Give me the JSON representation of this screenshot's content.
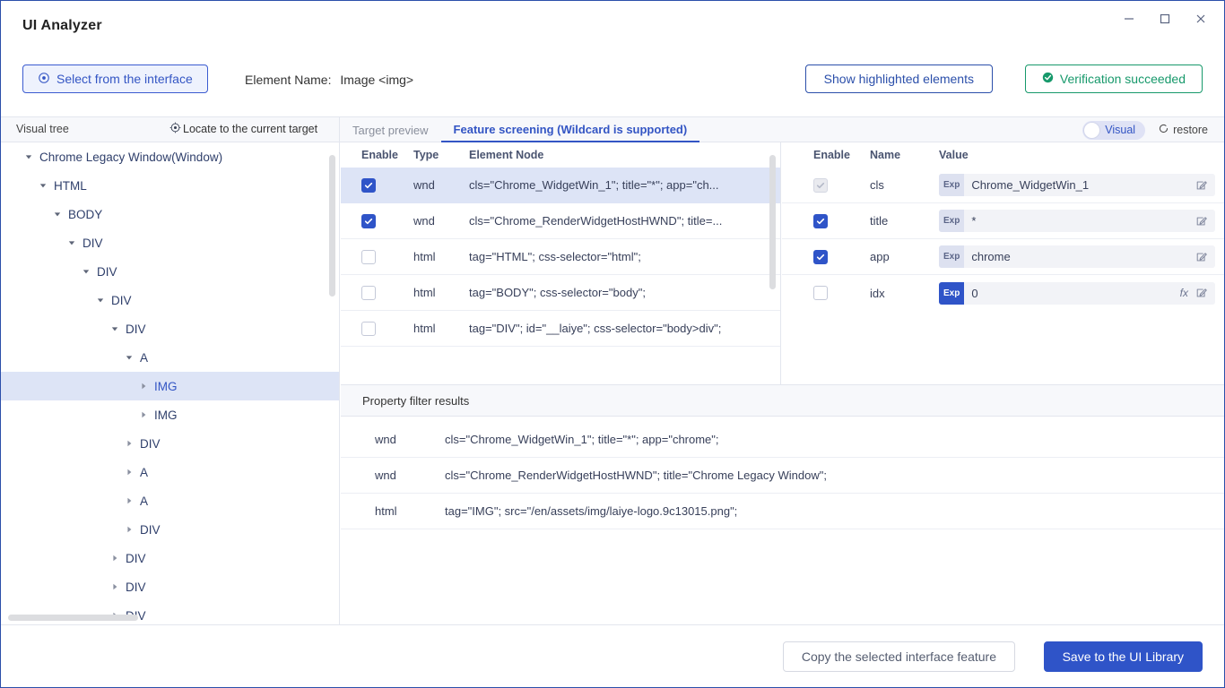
{
  "window": {
    "title": "UI Analyzer",
    "controls": {
      "minimize": "minimize-icon",
      "maximize": "maximize-icon",
      "close": "close-icon"
    }
  },
  "toolbar": {
    "select_button": "Select from the interface",
    "select_icon": "target-crosshair-icon",
    "element_name_label": "Element Name:",
    "element_name_value": "Image <img>",
    "show_highlighted": "Show highlighted elements",
    "verification": "Verification succeeded",
    "verification_icon": "check-circle-icon"
  },
  "subheader": {
    "visual_tree": "Visual tree",
    "locate_target": "Locate to the current target",
    "locate_icon": "target-crosshair-icon",
    "toggle_label": "Visual",
    "restore_label": "restore",
    "restore_icon": "refresh-icon"
  },
  "tabs": [
    {
      "label": "Target preview",
      "active": false
    },
    {
      "label": "Feature screening (Wildcard is supported)",
      "active": true
    }
  ],
  "tree": [
    {
      "label": "Chrome Legacy Window(Window)",
      "depth": 1,
      "twisty": "down",
      "selected": false
    },
    {
      "label": "HTML",
      "depth": 2,
      "twisty": "down",
      "selected": false
    },
    {
      "label": "BODY",
      "depth": 3,
      "twisty": "down",
      "selected": false
    },
    {
      "label": "DIV",
      "depth": 4,
      "twisty": "down",
      "selected": false
    },
    {
      "label": "DIV",
      "depth": 5,
      "twisty": "down",
      "selected": false
    },
    {
      "label": "DIV",
      "depth": 6,
      "twisty": "down",
      "selected": false
    },
    {
      "label": "DIV",
      "depth": 7,
      "twisty": "down",
      "selected": false
    },
    {
      "label": "A",
      "depth": 8,
      "twisty": "down",
      "selected": false
    },
    {
      "label": "IMG",
      "depth": 9,
      "twisty": "right",
      "selected": true
    },
    {
      "label": "IMG",
      "depth": 9,
      "twisty": "right",
      "selected": false
    },
    {
      "label": "DIV",
      "depth": 8,
      "twisty": "right",
      "selected": false
    },
    {
      "label": "A",
      "depth": 8,
      "twisty": "right",
      "selected": false
    },
    {
      "label": "A",
      "depth": 8,
      "twisty": "right",
      "selected": false
    },
    {
      "label": "DIV",
      "depth": 8,
      "twisty": "right",
      "selected": false
    },
    {
      "label": "DIV",
      "depth": 7,
      "twisty": "right",
      "selected": false
    },
    {
      "label": "DIV",
      "depth": 7,
      "twisty": "right",
      "selected": false
    },
    {
      "label": "DIV",
      "depth": 7,
      "twisty": "right",
      "selected": false
    }
  ],
  "node_table": {
    "columns": [
      "Enable",
      "Type",
      "Element Node"
    ],
    "rows": [
      {
        "enabled": true,
        "type": "wnd",
        "node": "cls=\"Chrome_WidgetWin_1\"; title=\"*\"; app=\"ch...",
        "selected": true
      },
      {
        "enabled": true,
        "type": "wnd",
        "node": "cls=\"Chrome_RenderWidgetHostHWND\"; title=...",
        "selected": false
      },
      {
        "enabled": false,
        "type": "html",
        "node": "tag=\"HTML\"; css-selector=\"html\";",
        "selected": false
      },
      {
        "enabled": false,
        "type": "html",
        "node": "tag=\"BODY\"; css-selector=\"body\";",
        "selected": false
      },
      {
        "enabled": false,
        "type": "html",
        "node": "tag=\"DIV\"; id=\"__laiye\"; css-selector=\"body>div\";",
        "selected": false
      }
    ]
  },
  "prop_table": {
    "columns": [
      "Enable",
      "Name",
      "Value"
    ],
    "rows": [
      {
        "enabled": true,
        "disabled_cb": true,
        "name": "cls",
        "exp": "Exp",
        "exp_active": false,
        "value": "Chrome_WidgetWin_1",
        "has_fx": false
      },
      {
        "enabled": true,
        "disabled_cb": false,
        "name": "title",
        "exp": "Exp",
        "exp_active": false,
        "value": "*",
        "has_fx": false
      },
      {
        "enabled": true,
        "disabled_cb": false,
        "name": "app",
        "exp": "Exp",
        "exp_active": false,
        "value": "chrome",
        "has_fx": false
      },
      {
        "enabled": false,
        "disabled_cb": false,
        "name": "idx",
        "exp": "Exp",
        "exp_active": true,
        "value": "0",
        "has_fx": true
      }
    ]
  },
  "filter_results": {
    "title": "Property filter results",
    "rows": [
      {
        "type": "wnd",
        "value": "cls=\"Chrome_WidgetWin_1\"; title=\"*\"; app=\"chrome\";"
      },
      {
        "type": "wnd",
        "value": "cls=\"Chrome_RenderWidgetHostHWND\"; title=\"Chrome Legacy Window\";"
      },
      {
        "type": "html",
        "value": "tag=\"IMG\"; src=\"/en/assets/img/laiye-logo.9c13015.png\";"
      }
    ]
  },
  "footer": {
    "copy_button": "Copy the selected interface feature",
    "save_button": "Save to the UI Library"
  },
  "colors": {
    "accent": "#2f54c8",
    "accent_text": "#3355c4",
    "success": "#17996b",
    "selection": "#dde4f6",
    "panel_bg": "#f7f8fb"
  }
}
